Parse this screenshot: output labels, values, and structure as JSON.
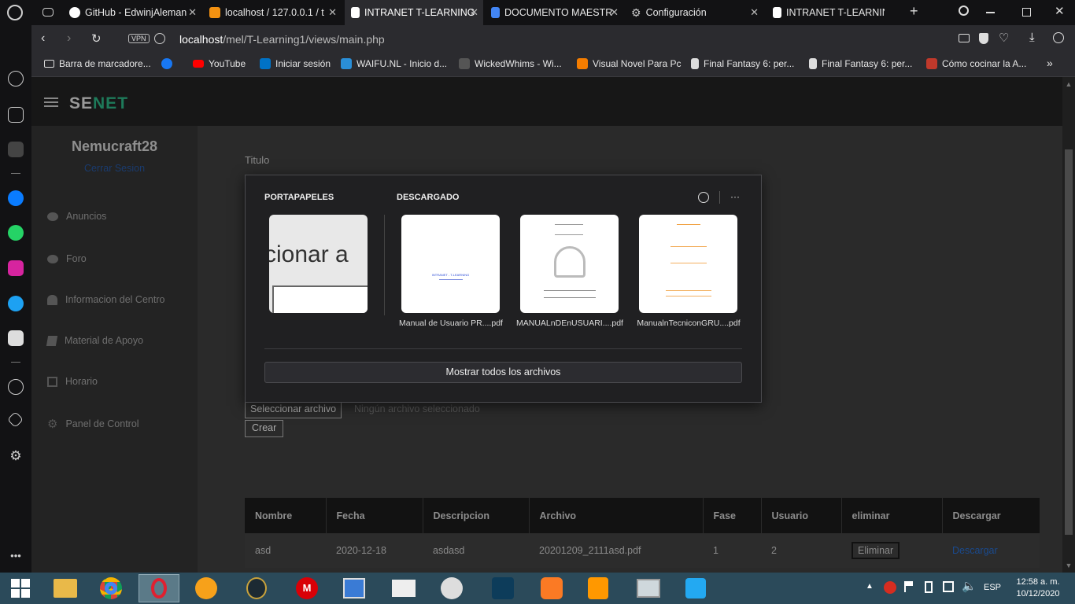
{
  "browser": {
    "tabs": [
      {
        "label": "GitHub - EdwinjAleman",
        "icon": "github-icon",
        "color": "#ffffff"
      },
      {
        "label": "localhost / 127.0.0.1 / t",
        "icon": "phpmyadmin-icon",
        "color": "#f29111"
      },
      {
        "label": "INTRANET T-LEARNING",
        "icon": "document-icon",
        "color": "#ffffff",
        "active": true
      },
      {
        "label": "DOCUMENTO MAESTR",
        "icon": "google-docs-icon",
        "color": "#4285f4"
      },
      {
        "label": "Configuración",
        "icon": "gear-icon",
        "color": "#cccccc"
      },
      {
        "label": "INTRANET T-LEARNING",
        "icon": "document-icon",
        "color": "#ffffff"
      }
    ],
    "new_tab": "+",
    "vpn_badge": "VPN",
    "url_host": "localhost",
    "url_path": "/mel/T-Learning1/views/main.php",
    "bookmarks": [
      {
        "label": "Barra de marcadore...",
        "icon": "folder-icon",
        "color": "#dddddd"
      },
      {
        "label": "",
        "icon": "facebook-icon",
        "color": "#1877f2"
      },
      {
        "label": "YouTube",
        "icon": "youtube-icon",
        "color": "#ff0000"
      },
      {
        "label": "Iniciar sesión",
        "icon": "outlook-icon",
        "color": "#0072c6"
      },
      {
        "label": "WAIFU.NL - Inicio d...",
        "icon": "waifu-icon",
        "color": "#2a8fd8"
      },
      {
        "label": "WickedWhims - Wi...",
        "icon": "wickedwhims-icon",
        "color": "#444444"
      },
      {
        "label": "Visual Novel Para Pc",
        "icon": "blogger-icon",
        "color": "#f57d00"
      },
      {
        "label": "Final Fantasy 6: per...",
        "icon": "page-icon",
        "color": "#dddddd"
      },
      {
        "label": "Final Fantasy 6: per...",
        "icon": "page-icon",
        "color": "#dddddd"
      },
      {
        "label": "Cómo cocinar la A...",
        "icon": "recipe-icon",
        "color": "#c0392b"
      }
    ],
    "more": "»"
  },
  "site": {
    "logo_a": "SE",
    "logo_b": "NET",
    "logo_color_a": "#9a9a9a",
    "logo_color_b": "#1e7a5a",
    "user": "Nemucraft28",
    "logout": "Cerrar Sesion",
    "nav": [
      {
        "label": "Anuncios",
        "icon": "chat-icon"
      },
      {
        "label": "Foro",
        "icon": "comments-icon"
      },
      {
        "label": "Informacion del Centro",
        "icon": "bell-icon"
      },
      {
        "label": "Material de Apoyo",
        "icon": "book-icon"
      },
      {
        "label": "Horario",
        "icon": "calendar-icon"
      },
      {
        "label": "Panel de Control",
        "icon": "cogs-icon"
      }
    ],
    "form": {
      "title_label": "Titulo",
      "file_button": "Seleccionar archivo",
      "file_status": "Ningún archivo seleccionado",
      "submit": "Crear"
    },
    "table": {
      "headers": [
        "Nombre",
        "Fecha",
        "Descripcion",
        "Archivo",
        "Fase",
        "Usuario",
        "eliminar",
        "Descargar"
      ],
      "rows": [
        [
          "asd",
          "2020-12-18",
          "asdasd",
          "20201209_2111asd.pdf",
          "1",
          "2",
          "Eliminar",
          "Descargar"
        ]
      ]
    }
  },
  "popup": {
    "clipboard_title": "PORTAPAPELES",
    "downloads_title": "DESCARGADO",
    "clipboard_text": "cionar a",
    "files": [
      {
        "name": "Manual de Usuario PR....pdf",
        "preview": "INTRANET - T-LEARNING"
      },
      {
        "name": "MANUALnDEnUSUARI....pdf",
        "preview": ""
      },
      {
        "name": "ManualnTecniconGRU....pdf",
        "preview": ""
      }
    ],
    "show_all": "Mostrar todos los archivos"
  },
  "taskbar": {
    "apps": [
      "file-explorer-icon",
      "chrome-icon",
      "opera-icon",
      "orange-app-icon",
      "league-of-legends-icon",
      "mega-icon",
      "video-player-icon",
      "game-icon",
      "app-icon",
      "mysql-workbench-icon",
      "xampp-icon",
      "sublime-text-icon",
      "monitor-icon",
      "vscode-icon"
    ],
    "lang": "ESP",
    "time": "12:58 a. m.",
    "date": "10/12/2020"
  }
}
